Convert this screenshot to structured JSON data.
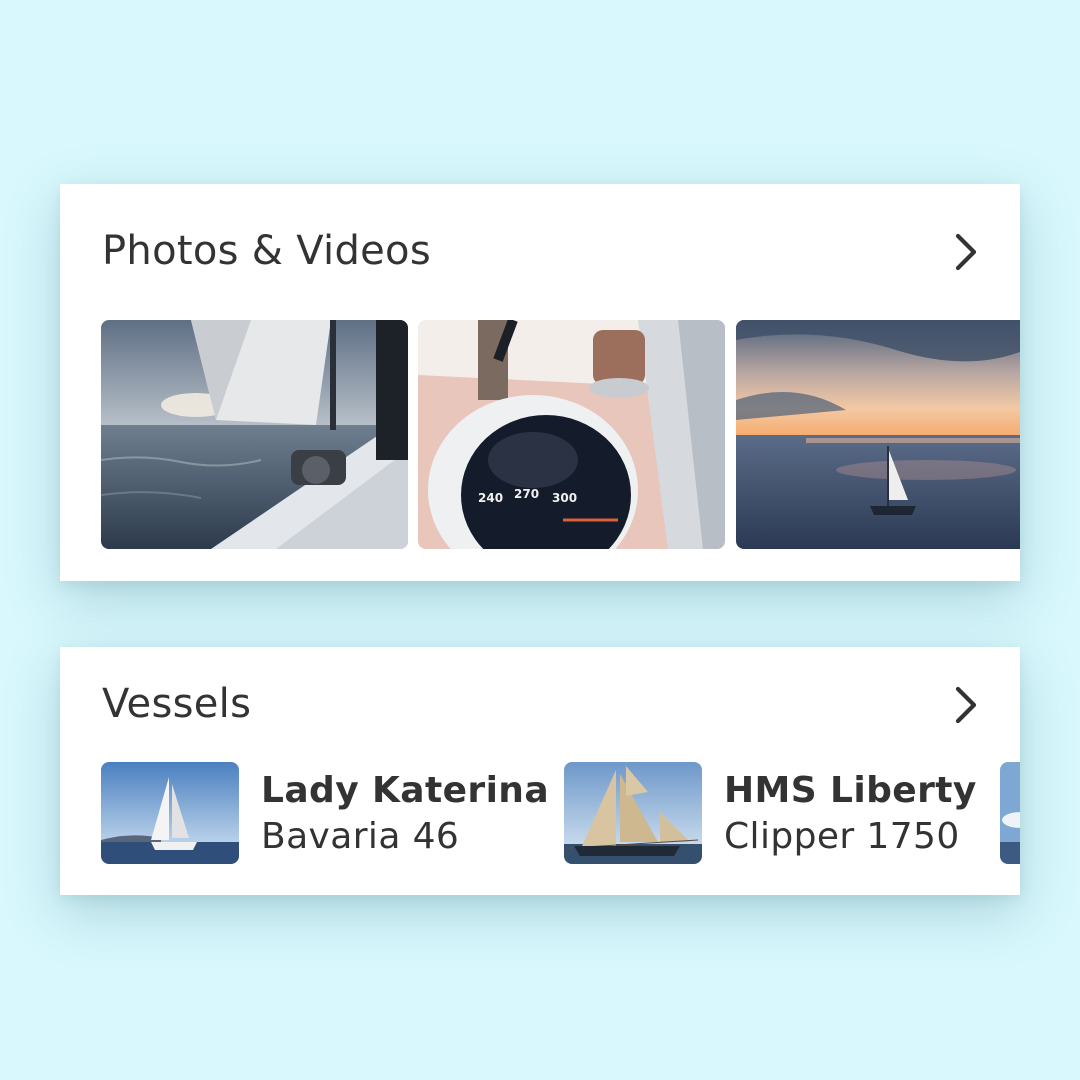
{
  "photos_section": {
    "title": "Photos & Videos",
    "more_icon": "chevron-right-icon",
    "items": [
      {
        "subject": "sailboat deck with sail at sunset"
      },
      {
        "subject": "ship compass on deck"
      },
      {
        "subject": "sailboat on the sea at sunset"
      }
    ]
  },
  "vessels_section": {
    "title": "Vessels",
    "more_icon": "chevron-right-icon",
    "items": [
      {
        "name": "Lady Katerina",
        "model": "Bavaria 46"
      },
      {
        "name": "HMS Liberty",
        "model": "Clipper 1750"
      },
      {
        "name": "",
        "model": ""
      }
    ]
  },
  "colors": {
    "background": "#d8f8fd",
    "card": "#ffffff",
    "text": "#333333"
  }
}
